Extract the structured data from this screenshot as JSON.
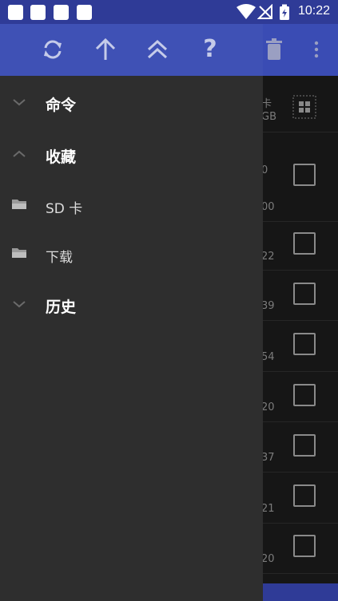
{
  "status_bar": {
    "time": "10:22",
    "icons": [
      "notification-square-icon",
      "notification-square-icon",
      "notification-square-icon",
      "notification-square-icon",
      "wifi-icon",
      "no-signal-icon",
      "battery-charging-icon"
    ]
  },
  "drawer_header": {
    "buttons": [
      {
        "icon": "refresh-icon"
      },
      {
        "icon": "arrow-up-icon"
      },
      {
        "icon": "double-chevron-up-icon"
      },
      {
        "icon": "help-icon",
        "label": "?"
      }
    ]
  },
  "drawer": {
    "items": [
      {
        "label": "命令",
        "icon": "chevron-down-icon",
        "type": "section"
      },
      {
        "label": "收藏",
        "icon": "chevron-up-icon",
        "type": "section"
      },
      {
        "label": "SD 卡",
        "icon": "folder-icon",
        "type": "item"
      },
      {
        "label": "下载",
        "icon": "folder-icon",
        "type": "item"
      },
      {
        "label": "历史",
        "icon": "chevron-down-icon",
        "type": "section"
      }
    ]
  },
  "background_app": {
    "toolbar_icons": [
      "trash-icon",
      "more-vert-icon"
    ],
    "header_text_line1": "卡",
    "header_text_line2": "GB",
    "row_texts": [
      "0",
      "00",
      "22",
      "39",
      "54",
      "20",
      "37",
      "21",
      "20"
    ]
  },
  "colors": {
    "status_bar": "#2f3b97",
    "drawer_header": "#3f51b5",
    "drawer_bg": "#2e2e2e",
    "app_toolbar": "#3a4cb4"
  }
}
